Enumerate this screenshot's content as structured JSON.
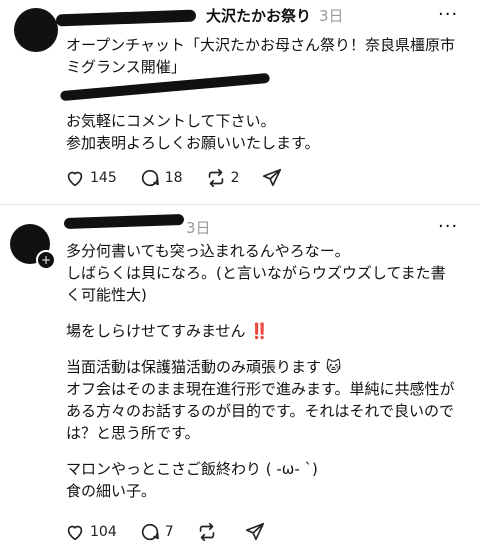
{
  "post1": {
    "username": "大沢たかお祭り",
    "time": "3日",
    "lines": [
      "オープンチャット「大沢たかお母さん祭り！奈良県橿原市",
      "ミグランス開催」"
    ],
    "lines2": [
      "お気軽にコメントして下さい。",
      "参加表明よろしくお願いいたします。"
    ],
    "likes": "145",
    "comments": "18",
    "reposts": "2"
  },
  "post2": {
    "time": "3日",
    "p1": [
      "多分何書いても突っ込まれるんやろなー。",
      "しばらくは貝になろ。(と言いながらウズウズしてまた書",
      "く可能性大)"
    ],
    "p2": "場をしらけせてすみません",
    "p2_emoji": "‼️",
    "p3_line1": "当面活動は保護猫活動のみ頑張ります",
    "p3_emoji": "🐱",
    "p3_rest": [
      "オフ会はそのまま現在進行形で進みます。単純に共感性が",
      "ある方々のお話するのが目的です。それはそれで良いので",
      "は？と思う所です。"
    ],
    "p4": [
      "マロンやっとこさご飯終わり ( -ω- `)",
      "食の細い子。"
    ],
    "likes": "104",
    "comments": "7"
  },
  "icons": [
    "heart-icon",
    "comment-icon",
    "repost-icon",
    "share-icon",
    "more-icon"
  ]
}
